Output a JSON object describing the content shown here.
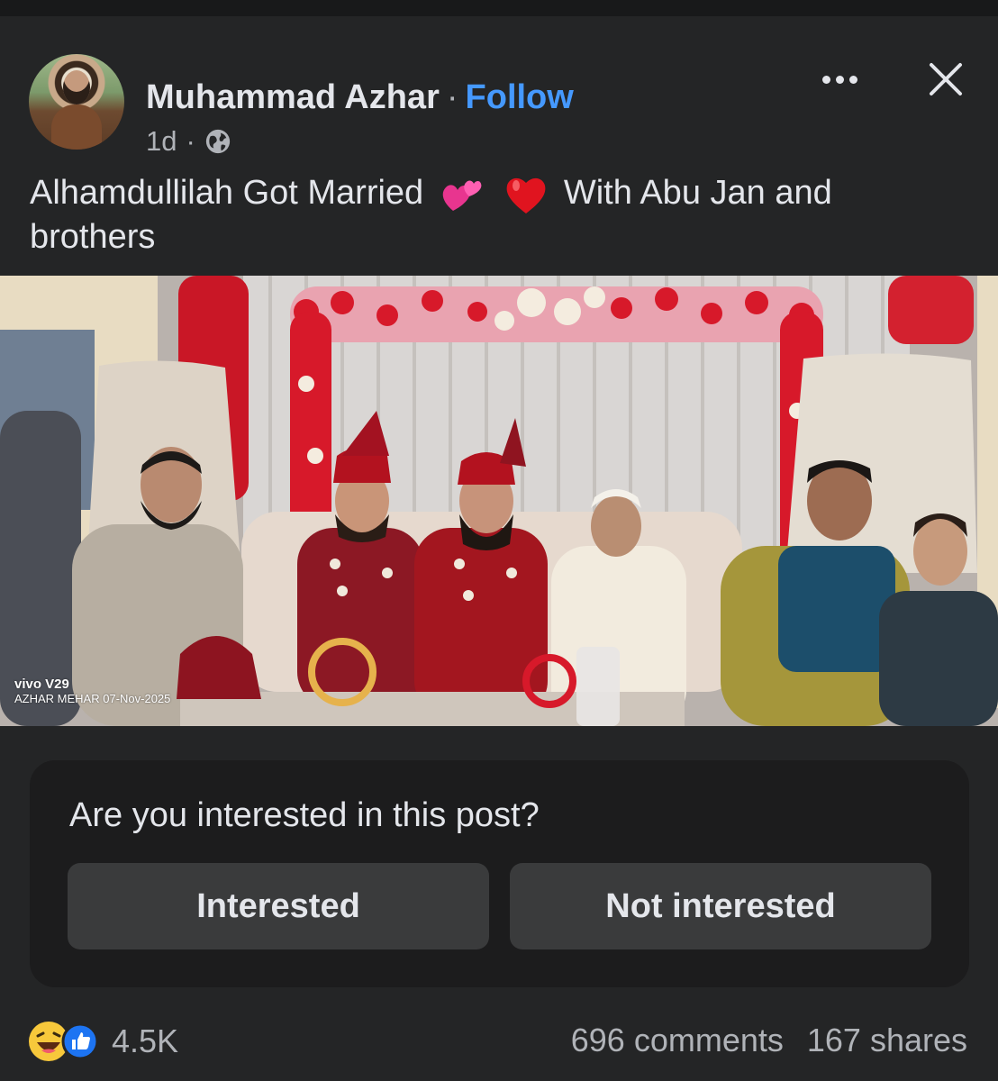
{
  "post": {
    "author_name": "Muhammad Azhar",
    "separator": "·",
    "follow_label": "Follow",
    "time": "1d",
    "time_separator": "·",
    "audience_icon": "globe-icon",
    "caption_part1": "Alhamdullilah Got Married",
    "caption_emoji1": "💕",
    "caption_emoji2": "❤️",
    "caption_part2": "With Abu Jan and brothers"
  },
  "photo": {
    "watermark_brand": "vivo V29",
    "watermark_text": "AZHAR MEHAR  07-Nov-2025"
  },
  "interest_prompt": {
    "question": "Are you interested in this post?",
    "interested_label": "Interested",
    "not_interested_label": "Not interested"
  },
  "footer": {
    "reaction_icons": [
      "laugh-reaction-icon",
      "like-reaction-icon"
    ],
    "reaction_count": "4.5K",
    "comments": "696 comments",
    "shares": "167 shares"
  },
  "colors": {
    "background": "#242526",
    "text": "#e4e6eb",
    "secondary_text": "#b0b3b8",
    "follow_blue": "#4599ff",
    "button_bg": "#3a3b3c",
    "card_bg": "#1c1c1d"
  }
}
